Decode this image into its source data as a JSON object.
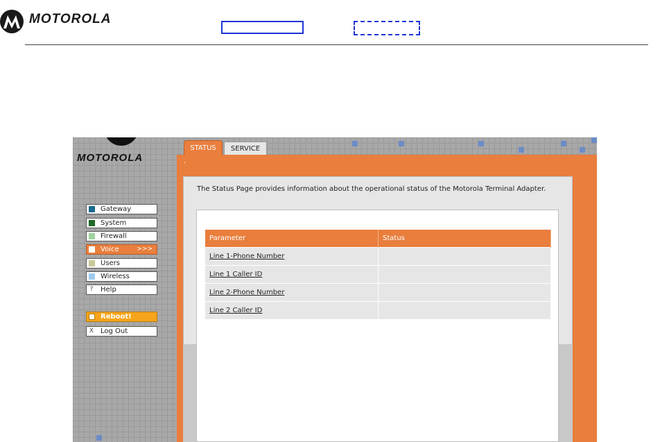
{
  "document": {
    "brand": "MOTOROLA"
  },
  "sidebar": {
    "brand": "MOTOROLA",
    "items": [
      {
        "label": "Gateway",
        "color": "#1a6a8f"
      },
      {
        "label": "System",
        "color": "#1f6b2a"
      },
      {
        "label": "Firewall",
        "color": "#9dd39d"
      },
      {
        "label": "Voice",
        "color": "#ffffff",
        "arrows": ">>>"
      },
      {
        "label": "Users",
        "color": "#c9c99a"
      },
      {
        "label": "Wireless",
        "color": "#9fc9ee"
      },
      {
        "label": "Help",
        "glyph": "?"
      }
    ],
    "reboot": {
      "label": "Reboot!"
    },
    "logout": {
      "label": "Log Out",
      "glyph": "X"
    }
  },
  "tabs": [
    {
      "label": "STATUS",
      "active": true
    },
    {
      "label": "SERVICE",
      "active": false
    }
  ],
  "page": {
    "dot": ".",
    "description": "The Status Page provides information about the operational status of the Motorola Terminal Adapter."
  },
  "table": {
    "headers": [
      "Parameter",
      "Status"
    ],
    "rows": [
      {
        "param": "Line 1-Phone Number",
        "status": ""
      },
      {
        "param": "Line 1 Caller ID",
        "status": ""
      },
      {
        "param": "Line 2-Phone Number",
        "status": ""
      },
      {
        "param": "Line 2 Caller ID",
        "status": ""
      }
    ]
  },
  "colors": {
    "accent": "#e97e3d",
    "reboot": "#f6a51a",
    "link_box": "#1d35d6"
  }
}
